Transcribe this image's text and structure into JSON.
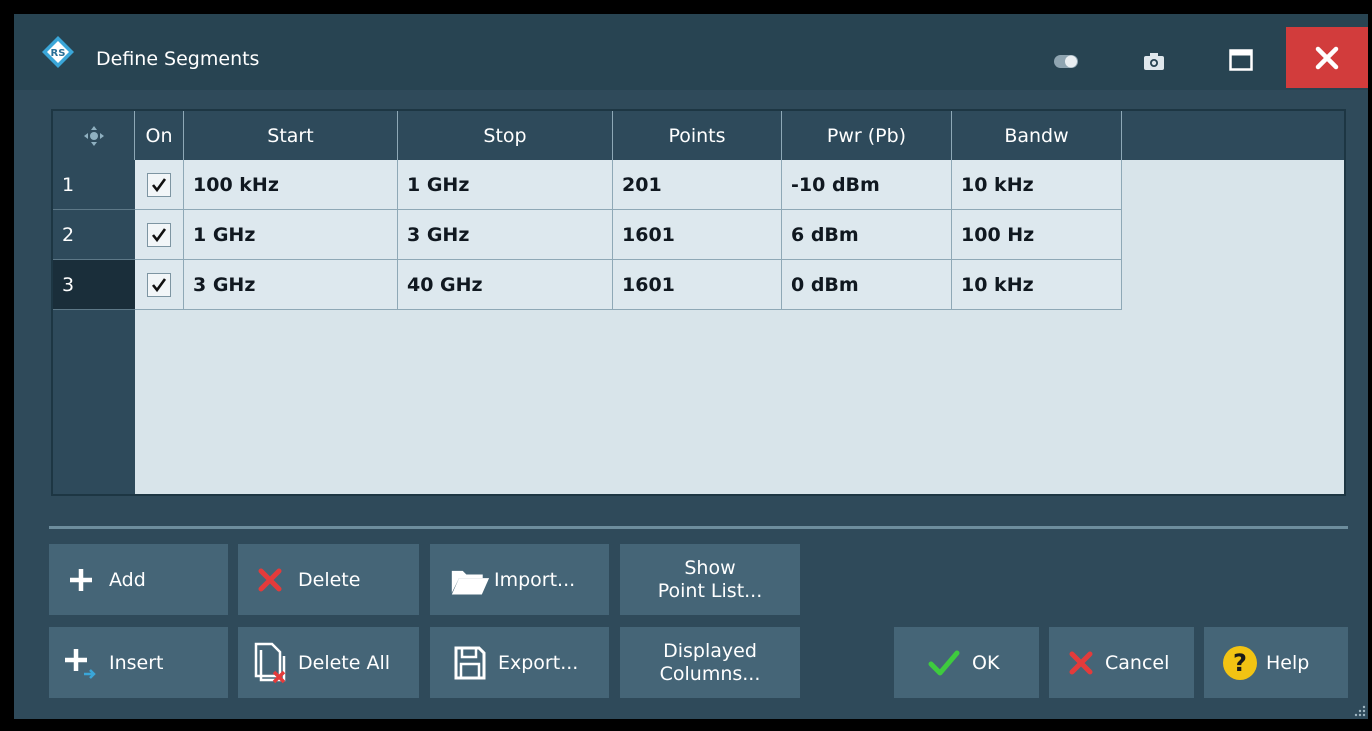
{
  "window": {
    "title": "Define Segments"
  },
  "table": {
    "columns": [
      "On",
      "Start",
      "Stop",
      "Points",
      "Pwr (Pb)",
      "Bandw"
    ],
    "rows": [
      {
        "index": "1",
        "on": true,
        "start": "100 kHz",
        "stop": "1 GHz",
        "points": "201",
        "pwr": "-10 dBm",
        "bandw": "10 kHz"
      },
      {
        "index": "2",
        "on": true,
        "start": "1 GHz",
        "stop": "3 GHz",
        "points": "1601",
        "pwr": "6 dBm",
        "bandw": "100 Hz"
      },
      {
        "index": "3",
        "on": true,
        "start": "3 GHz",
        "stop": "40 GHz",
        "points": "1601",
        "pwr": "0 dBm",
        "bandw": "10 kHz"
      }
    ],
    "selected_row": "3"
  },
  "buttons": {
    "add": "Add",
    "insert": "Insert",
    "delete": "Delete",
    "delete_all": "Delete All",
    "import": "Import...",
    "export": "Export...",
    "show_point_list_1": "Show",
    "show_point_list_2": "Point List...",
    "displayed_columns_1": "Displayed",
    "displayed_columns_2": "Columns...",
    "ok": "OK",
    "cancel": "Cancel",
    "help": "Help"
  },
  "icons": {
    "logo": "rohde-schwarz-logo",
    "toggle": "toggle-icon",
    "camera": "camera-icon",
    "maximize": "maximize-icon",
    "close": "close-icon"
  },
  "colors": {
    "title_bg": "#284452",
    "dialog_bg": "#2f4a5a",
    "button_bg": "#456577",
    "close_bg": "#d23c3c",
    "ok_check": "#3ecb3e",
    "cancel_x": "#e33b3b",
    "help_bg": "#f2c313"
  }
}
